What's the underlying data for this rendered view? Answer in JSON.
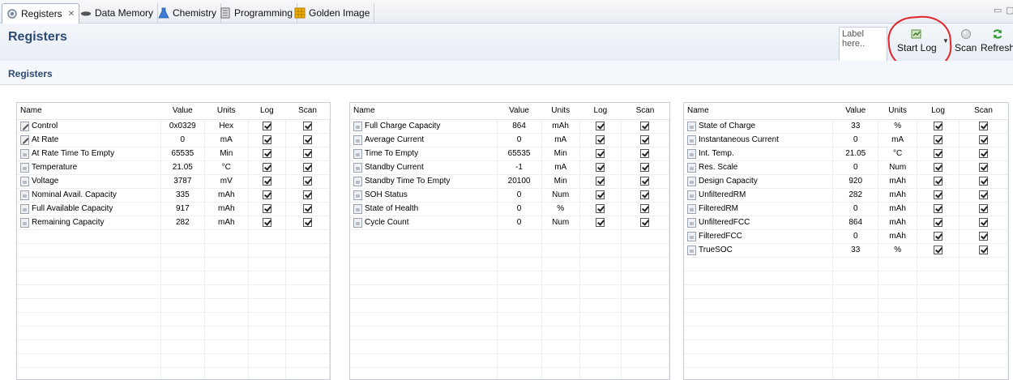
{
  "tabs": [
    {
      "label": "Registers",
      "active": true,
      "icon": "gear-icon",
      "closable": true
    },
    {
      "label": "Data Memory",
      "active": false,
      "icon": "memory-icon"
    },
    {
      "label": "Chemistry",
      "active": false,
      "icon": "flask-icon"
    },
    {
      "label": "Programming",
      "active": false,
      "icon": "chip-icon"
    },
    {
      "label": "Golden Image",
      "active": false,
      "icon": "grid-image-icon"
    }
  ],
  "header": {
    "title": "Registers",
    "label_placeholder": "Label here..",
    "start_log_label": "Start Log",
    "scan_label": "Scan",
    "refresh_label": "Refresh"
  },
  "section": {
    "title": "Registers"
  },
  "columns": {
    "name": "Name",
    "value": "Value",
    "units": "Units",
    "log": "Log",
    "scan": "Scan"
  },
  "panels": [
    {
      "rows": [
        {
          "name": "Control",
          "value": "0x0329",
          "units": "Hex",
          "log": true,
          "scan": true,
          "icon": "editable"
        },
        {
          "name": "At Rate",
          "value": "0",
          "units": "mA",
          "log": true,
          "scan": true,
          "icon": "editable"
        },
        {
          "name": "At Rate Time To Empty",
          "value": "65535",
          "units": "Min",
          "log": true,
          "scan": true,
          "icon": "locked"
        },
        {
          "name": "Temperature",
          "value": "21.05",
          "units": "°C",
          "log": true,
          "scan": true,
          "icon": "locked"
        },
        {
          "name": "Voltage",
          "value": "3787",
          "units": "mV",
          "log": true,
          "scan": true,
          "icon": "locked"
        },
        {
          "name": "Nominal Avail. Capacity",
          "value": "335",
          "units": "mAh",
          "log": true,
          "scan": true,
          "icon": "locked"
        },
        {
          "name": "Full Available Capacity",
          "value": "917",
          "units": "mAh",
          "log": true,
          "scan": true,
          "icon": "locked"
        },
        {
          "name": "Remaining Capacity",
          "value": "282",
          "units": "mAh",
          "log": true,
          "scan": true,
          "icon": "locked"
        }
      ]
    },
    {
      "rows": [
        {
          "name": "Full Charge Capacity",
          "value": "864",
          "units": "mAh",
          "log": true,
          "scan": true,
          "icon": "locked"
        },
        {
          "name": "Average Current",
          "value": "0",
          "units": "mA",
          "log": true,
          "scan": true,
          "icon": "locked"
        },
        {
          "name": "Time To Empty",
          "value": "65535",
          "units": "Min",
          "log": true,
          "scan": true,
          "icon": "locked"
        },
        {
          "name": "Standby Current",
          "value": "-1",
          "units": "mA",
          "log": true,
          "scan": true,
          "icon": "locked"
        },
        {
          "name": "Standby Time To Empty",
          "value": "20100",
          "units": "Min",
          "log": true,
          "scan": true,
          "icon": "locked"
        },
        {
          "name": "SOH Status",
          "value": "0",
          "units": "Num",
          "log": true,
          "scan": true,
          "icon": "locked"
        },
        {
          "name": "State of Health",
          "value": "0",
          "units": "%",
          "log": true,
          "scan": true,
          "icon": "locked"
        },
        {
          "name": "Cycle Count",
          "value": "0",
          "units": "Num",
          "log": true,
          "scan": true,
          "icon": "locked"
        }
      ]
    },
    {
      "rows": [
        {
          "name": "State of Charge",
          "value": "33",
          "units": "%",
          "log": true,
          "scan": true,
          "icon": "locked"
        },
        {
          "name": "Instantaneous Current",
          "value": "0",
          "units": "mA",
          "log": true,
          "scan": true,
          "icon": "locked"
        },
        {
          "name": "Int. Temp.",
          "value": "21.05",
          "units": "°C",
          "log": true,
          "scan": true,
          "icon": "locked"
        },
        {
          "name": "Res. Scale",
          "value": "0",
          "units": "Num",
          "log": true,
          "scan": true,
          "icon": "locked"
        },
        {
          "name": "Design Capacity",
          "value": "920",
          "units": "mAh",
          "log": true,
          "scan": true,
          "icon": "locked"
        },
        {
          "name": "UnfilteredRM",
          "value": "282",
          "units": "mAh",
          "log": true,
          "scan": true,
          "icon": "locked"
        },
        {
          "name": "FilteredRM",
          "value": "0",
          "units": "mAh",
          "log": true,
          "scan": true,
          "icon": "locked"
        },
        {
          "name": "UnfilteredFCC",
          "value": "864",
          "units": "mAh",
          "log": true,
          "scan": true,
          "icon": "locked"
        },
        {
          "name": "FilteredFCC",
          "value": "0",
          "units": "mAh",
          "log": true,
          "scan": true,
          "icon": "locked"
        },
        {
          "name": "TrueSOC",
          "value": "33",
          "units": "%",
          "log": true,
          "scan": true,
          "icon": "locked"
        }
      ]
    }
  ],
  "annotation_color": "#e3242b"
}
